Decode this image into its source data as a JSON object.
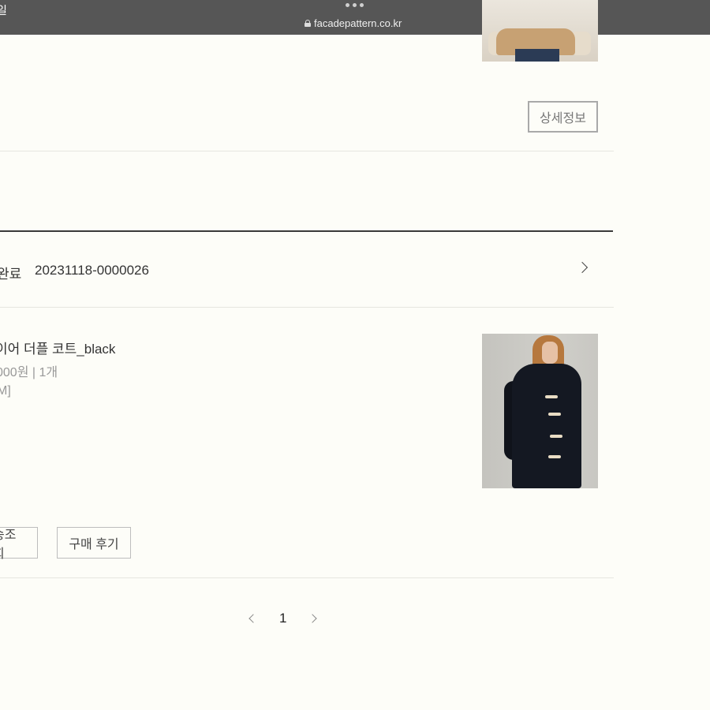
{
  "browser": {
    "clipped_left_text": "일",
    "url": "facadepattern.co.kr"
  },
  "top_item": {
    "detail_button": "상세정보"
  },
  "order": {
    "status": "완료",
    "number": "20231118-0000026"
  },
  "product": {
    "name": "이어 더플 코트_black",
    "price_qty": "000원 | 1개",
    "option": "M]"
  },
  "actions": {
    "delivery_button": "송조회",
    "review_button": "구매 후기"
  },
  "pagination": {
    "current_page": "1"
  },
  "colors": {
    "background": "#fdfdf8",
    "topbar": "#565656",
    "divider_dark": "#3a3a3a"
  }
}
